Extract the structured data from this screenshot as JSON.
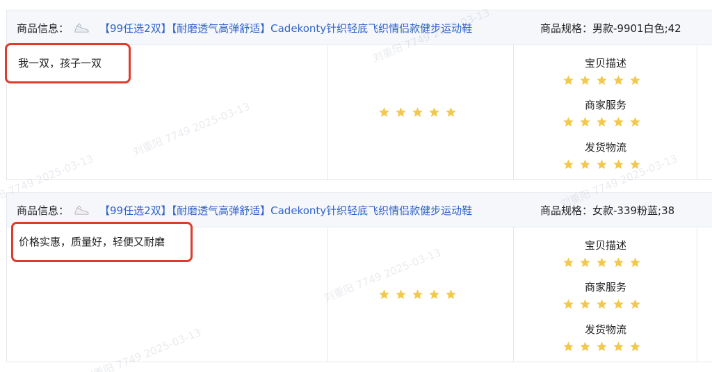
{
  "colors": {
    "link": "#2f62c9",
    "highlight_border": "#e03a2a",
    "star": "#f2c94c",
    "header_bg": "#f5f7fb",
    "border": "#e6e8ee"
  },
  "reviews": [
    {
      "info_label": "商品信息：",
      "product_icon": "shoe-icon",
      "product_title": "【99任选2双】【耐磨透气高弹舒适】Cadekonty针织轻底飞织情侣款健步运动鞋",
      "spec": "商品规格：男款-9901白色;42",
      "comment": "我一双，孩子一双",
      "overall_stars": 5,
      "ratings": [
        {
          "label": "宝贝描述",
          "stars": 5
        },
        {
          "label": "商家服务",
          "stars": 5
        },
        {
          "label": "发货物流",
          "stars": 5
        }
      ]
    },
    {
      "info_label": "商品信息：",
      "product_icon": "shoe-icon",
      "product_title": "【99任选2双】【耐磨透气高弹舒适】Cadekonty针织轻底飞织情侣款健步运动鞋",
      "spec": "商品规格：女款-339粉蓝;38",
      "comment": "价格实惠，质量好，轻便又耐磨",
      "overall_stars": 5,
      "ratings": [
        {
          "label": "宝贝描述",
          "stars": 5
        },
        {
          "label": "商家服务",
          "stars": 5
        },
        {
          "label": "发货物流",
          "stars": 5
        }
      ]
    }
  ],
  "watermarks": [
    "刘重阳 7749 2025-03-13",
    "刘重阳 7749 2025-03-13",
    "刘重阳 7749 2025-03-13",
    "刘重阳 7749 2025-03-13",
    "刘重阳 7749 2025-03-13",
    "刘重阳 7749 2025-03-13"
  ]
}
